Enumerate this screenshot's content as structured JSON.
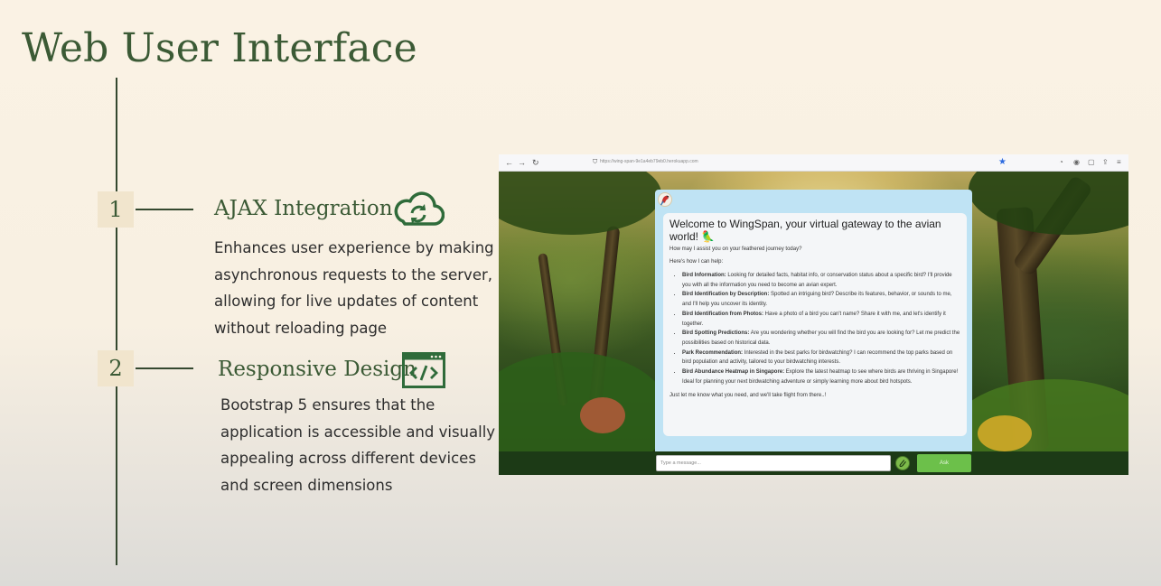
{
  "slide": {
    "title": "Web User Interface",
    "items": [
      {
        "number": "1",
        "title": "AJAX Integration",
        "icon": "cloud-sync-icon",
        "description_lines": [
          "Enhances user experience by making",
          "asynchronous requests to the server,",
          "allowing for live updates of content",
          "without reloading page"
        ]
      },
      {
        "number": "2",
        "title": "Responsive Design",
        "icon": "code-window-icon",
        "description_lines": [
          "Bootstrap 5 ensures that the",
          "application is accessible and visually",
          "appealing across different devices",
          "and screen dimensions"
        ]
      }
    ],
    "colors": {
      "heading_green": "#3b5a35",
      "timeline": "#34482f",
      "number_box": "#f1e5cd",
      "background": "#faf2e4"
    }
  },
  "browser": {
    "url": "https://wing-span-9e1a4eb79eb0.herokuapp.com",
    "chat": {
      "welcome": "Welcome to WingSpan, your virtual gateway to the avian world! 🦜",
      "question": "How may I assist you on your feathered journey today?",
      "intro": "Here's how I can help:",
      "features": [
        {
          "title": "Bird Information:",
          "text": "Looking for detailed facts, habitat info, or conservation status about a specific bird? I'll provide you with all the information you need to become an avian expert."
        },
        {
          "title": "Bird Identification by Description:",
          "text": "Spotted an intriguing bird? Describe its features, behavior, or sounds to me, and I'll help you uncover its identity."
        },
        {
          "title": "Bird Identification from Photos:",
          "text": "Have a photo of a bird you can't name? Share it with me, and let's identify it together."
        },
        {
          "title": "Bird Spotting Predictions:",
          "text": "Are you wondering whether you will find the bird you are looking for? Let me predict the possibilities based on historical data."
        },
        {
          "title": "Park Recommendation:",
          "text": "Interested in the best parks for birdwatching? I can recommend the top parks based on bird population and activity, tailored to your birdwatching interests."
        },
        {
          "title": "Bird Abundance Heatmap in Singapore:",
          "text": "Explore the latest heatmap to see where birds are thriving in Singapore! Ideal for planning your next birdwatching adventure or simply learning more about bird hotspots."
        }
      ],
      "closing": "Just let me know what you need, and we'll take flight from there..!",
      "input_placeholder": "Type a message...",
      "ask_label": "Ask"
    }
  }
}
